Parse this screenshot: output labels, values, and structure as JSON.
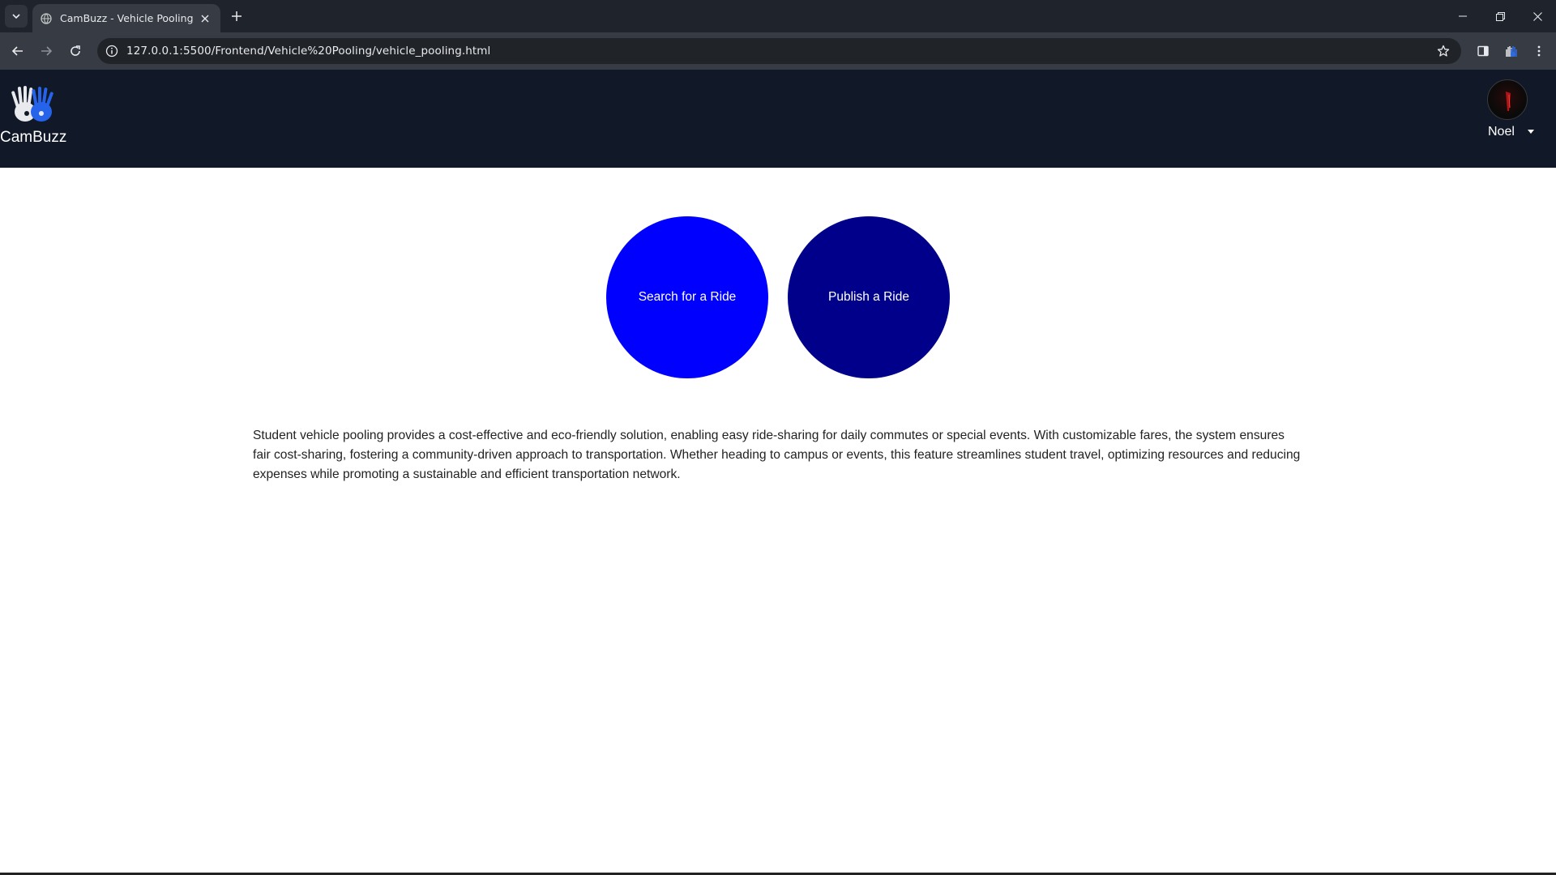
{
  "browser": {
    "tab_title": "CamBuzz - Vehicle Pooling",
    "url": "127.0.0.1:5500/Frontend/Vehicle%20Pooling/vehicle_pooling.html"
  },
  "header": {
    "brand_name": "CamBuzz",
    "user_name": "Noel"
  },
  "actions": {
    "search_label": "Search for a Ride",
    "publish_label": "Publish a Ride"
  },
  "main": {
    "description": "Student vehicle pooling provides a cost-effective and eco-friendly solution, enabling easy ride-sharing for daily commutes or special events. With customizable fares, the system ensures fair cost-sharing, fostering a community-driven approach to transportation. Whether heading to campus or events, this feature streamlines student travel, optimizing resources and reducing expenses while promoting a sustainable and efficient transportation network."
  },
  "colors": {
    "header_bg": "#111827",
    "search_button": "#0000ff",
    "publish_button": "#00008b"
  },
  "icons": {
    "brand_logo": "hands-logo-icon",
    "avatar": "user-avatar"
  }
}
